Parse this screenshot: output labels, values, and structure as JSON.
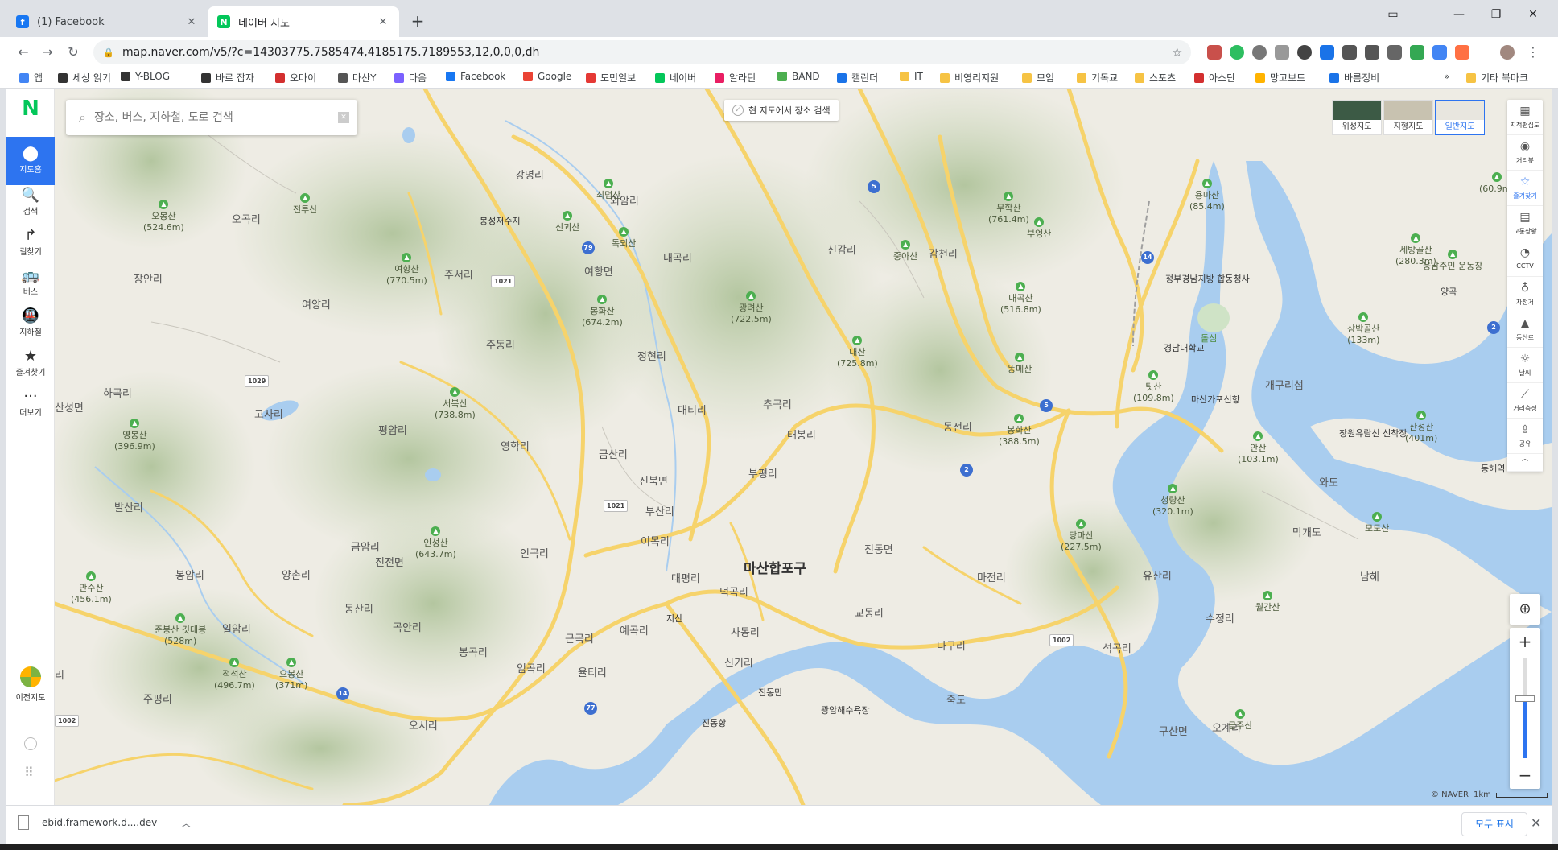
{
  "browser": {
    "tabs": [
      {
        "title": "(1) Facebook",
        "icon": "facebook-icon",
        "color": "#1877f2"
      },
      {
        "title": "네이버 지도",
        "icon": "naver-map-icon",
        "color": "#03c75a"
      }
    ],
    "url": "map.naver.com/v5/?c=14303775.7585474,4185175.7189553,12,0,0,0,dh"
  },
  "bookmarks": [
    {
      "label": "앱",
      "color": "#4285f4"
    },
    {
      "label": "세상 읽기",
      "color": "#333"
    },
    {
      "label": "Y-BLOG",
      "color": "#333"
    },
    {
      "label": "바로 잡자",
      "color": "#333"
    },
    {
      "label": "오마이",
      "color": "#d32f2f"
    },
    {
      "label": "마산Y",
      "color": "#555"
    },
    {
      "label": "다음",
      "color": "#7b61ff"
    },
    {
      "label": "Facebook",
      "color": "#1877f2"
    },
    {
      "label": "Google",
      "color": "#ea4335"
    },
    {
      "label": "도민일보",
      "color": "#e53935"
    },
    {
      "label": "네이버",
      "color": "#03c75a"
    },
    {
      "label": "알라딘",
      "color": "#e91e63"
    },
    {
      "label": "BAND",
      "color": "#4caf50"
    },
    {
      "label": "캘린더",
      "color": "#1a73e8"
    },
    {
      "label": "IT",
      "color": "#f6c344"
    },
    {
      "label": "비영리지원",
      "color": "#f6c344"
    },
    {
      "label": "모임",
      "color": "#f6c344"
    },
    {
      "label": "기독교",
      "color": "#f6c344"
    },
    {
      "label": "스포츠",
      "color": "#f6c344"
    },
    {
      "label": "아스단",
      "color": "#d32f2f"
    },
    {
      "label": "망고보드",
      "color": "#ffb300"
    },
    {
      "label": "바름정비",
      "color": "#1a73e8"
    }
  ],
  "bookmarks_more": "»",
  "bookmarks_other": "기타 북마크",
  "sidebar": {
    "logo": "N",
    "items": [
      {
        "label": "지도홈",
        "icon": "pin-icon",
        "glyph": "⬤"
      },
      {
        "label": "검색",
        "icon": "search-icon",
        "glyph": "🔍"
      },
      {
        "label": "길찾기",
        "icon": "directions-icon",
        "glyph": "↱"
      },
      {
        "label": "버스",
        "icon": "bus-icon",
        "glyph": "🚌"
      },
      {
        "label": "지하철",
        "icon": "subway-icon",
        "glyph": "🚇"
      },
      {
        "label": "즐겨찾기",
        "icon": "star-icon",
        "glyph": "★"
      },
      {
        "label": "더보기",
        "icon": "more-icon",
        "glyph": "···"
      }
    ],
    "legacy": "이전지도"
  },
  "search": {
    "placeholder": "장소, 버스, 지하철, 도로 검색"
  },
  "here_search": "현 지도에서 장소 검색",
  "map_types": [
    {
      "label": "위성지도",
      "color": "#3c5a45"
    },
    {
      "label": "지형지도",
      "color": "#c8c2b0"
    },
    {
      "label": "일반지도",
      "color": "#e8e6df"
    }
  ],
  "tools": [
    {
      "label": "지적편집도",
      "glyph": "▦"
    },
    {
      "label": "거리뷰",
      "glyph": "◉"
    },
    {
      "label": "즐겨찾기",
      "glyph": "☆"
    },
    {
      "label": "교통상황",
      "glyph": "▤"
    },
    {
      "label": "CCTV",
      "glyph": "◔"
    },
    {
      "label": "자전거",
      "glyph": "♁"
    },
    {
      "label": "등산로",
      "glyph": "▲"
    },
    {
      "label": "날씨",
      "glyph": "☼"
    },
    {
      "label": "거리측정",
      "glyph": "⟋"
    },
    {
      "label": "공유",
      "glyph": "⇪"
    }
  ],
  "zoom": {
    "level_fraction": 0.4
  },
  "scale": {
    "copyright": "© NAVER",
    "distance": "1km"
  },
  "map": {
    "city": "마산합포구",
    "towns": [
      {
        "name": "오곡리"
      },
      {
        "name": "장안리"
      },
      {
        "name": "여양리"
      },
      {
        "name": "하곡리"
      },
      {
        "name": "고사리"
      },
      {
        "name": "평암리"
      },
      {
        "name": "발산리"
      },
      {
        "name": "금암리"
      },
      {
        "name": "진전면"
      },
      {
        "name": "양촌리"
      },
      {
        "name": "동산리"
      },
      {
        "name": "곡안리"
      },
      {
        "name": "일암리"
      },
      {
        "name": "봉암리"
      },
      {
        "name": "주평리"
      },
      {
        "name": "주서리"
      },
      {
        "name": "주동리"
      },
      {
        "name": "여항면"
      },
      {
        "name": "영학리"
      },
      {
        "name": "인곡리"
      },
      {
        "name": "금산리"
      },
      {
        "name": "진북면"
      },
      {
        "name": "이목리"
      },
      {
        "name": "부산리"
      },
      {
        "name": "대티리"
      },
      {
        "name": "정현리"
      },
      {
        "name": "내곡리"
      },
      {
        "name": "외암리"
      },
      {
        "name": "강명리"
      },
      {
        "name": "추곡리"
      },
      {
        "name": "부평리"
      },
      {
        "name": "태봉리"
      },
      {
        "name": "신감리"
      },
      {
        "name": "감천리"
      },
      {
        "name": "동전리"
      },
      {
        "name": "진동면"
      },
      {
        "name": "마전리"
      },
      {
        "name": "교동리"
      },
      {
        "name": "대평리"
      },
      {
        "name": "덕곡리"
      },
      {
        "name": "사동리"
      },
      {
        "name": "예곡리"
      },
      {
        "name": "근곡리"
      },
      {
        "name": "봉곡리"
      },
      {
        "name": "임곡리"
      },
      {
        "name": "율티리"
      },
      {
        "name": "신기리"
      },
      {
        "name": "다구리"
      },
      {
        "name": "유산리"
      },
      {
        "name": "수정리"
      },
      {
        "name": "석곡리"
      },
      {
        "name": "구산면"
      },
      {
        "name": "오계리"
      },
      {
        "name": "오서리"
      },
      {
        "name": "개구리섬"
      },
      {
        "name": "막개도"
      },
      {
        "name": "와도"
      },
      {
        "name": "죽도"
      },
      {
        "name": "남해"
      },
      {
        "name": "리"
      },
      {
        "name": "산성면"
      }
    ],
    "mountains": [
      {
        "name": "오봉산",
        "elev": "(524.6m)"
      },
      {
        "name": "여항산",
        "elev": "(770.5m)"
      },
      {
        "name": "봉화산",
        "elev": "(674.2m)"
      },
      {
        "name": "광려산",
        "elev": "(722.5m)"
      },
      {
        "name": "대산",
        "elev": "(725.8m)"
      },
      {
        "name": "무학산",
        "elev": "(761.4m)"
      },
      {
        "name": "대곡산",
        "elev": "(516.8m)"
      },
      {
        "name": "서북산",
        "elev": "(738.8m)"
      },
      {
        "name": "영봉산",
        "elev": "(396.9m)"
      },
      {
        "name": "인성산",
        "elev": "(643.7m)"
      },
      {
        "name": "만수산",
        "elev": "(456.1m)"
      },
      {
        "name": "준봉산 깃대봉",
        "elev": "(528m)"
      },
      {
        "name": "적석산",
        "elev": "(496.7m)"
      },
      {
        "name": "으봉산",
        "elev": "(371m)"
      },
      {
        "name": "봉화산",
        "elev": "(388.5m)"
      },
      {
        "name": "팃산",
        "elev": "(109.8m)"
      },
      {
        "name": "청량산",
        "elev": "(320.1m)"
      },
      {
        "name": "당마산",
        "elev": "(227.5m)"
      },
      {
        "name": "안산",
        "elev": "(103.1m)"
      },
      {
        "name": "용마산",
        "elev": "(85.4m)"
      },
      {
        "name": "세방골산",
        "elev": "(280.3m)"
      },
      {
        "name": "삼박골산",
        "elev": "(133m)"
      },
      {
        "name": "산성산",
        "elev": "(401m)"
      },
      {
        "name": "모도산",
        "elev": ""
      },
      {
        "name": "월간산",
        "elev": ""
      },
      {
        "name": "금주산",
        "elev": ""
      },
      {
        "name": "전투산",
        "elev": ""
      },
      {
        "name": "쇠덤산",
        "elev": ""
      },
      {
        "name": "신괴산",
        "elev": ""
      },
      {
        "name": "독뫼산",
        "elev": ""
      },
      {
        "name": "중아산",
        "elev": ""
      },
      {
        "name": "부엉산",
        "elev": ""
      },
      {
        "name": "똥메산",
        "elev": ""
      },
      {
        "name": "웅남주민 운동장",
        "elev": ""
      },
      {
        "name": "",
        "elev": "(60.9m)"
      }
    ],
    "pois": [
      {
        "name": "봉성저수지"
      },
      {
        "name": "정부경남지방 합동청사"
      },
      {
        "name": "경남대학교"
      },
      {
        "name": "마산가포신항"
      },
      {
        "name": "창원유람선 선착장"
      },
      {
        "name": "돌섬"
      },
      {
        "name": "지산"
      },
      {
        "name": "진동만"
      },
      {
        "name": "광암해수욕장"
      },
      {
        "name": "진동항"
      },
      {
        "name": "양곡"
      },
      {
        "name": "동해역"
      }
    ],
    "routes": [
      {
        "num": "5",
        "kind": "blue"
      },
      {
        "num": "79",
        "kind": "blue"
      },
      {
        "num": "1021",
        "kind": "white"
      },
      {
        "num": "1029",
        "kind": "white"
      },
      {
        "num": "14",
        "kind": "blue"
      },
      {
        "num": "5",
        "kind": "blue"
      },
      {
        "num": "2",
        "kind": "blue"
      },
      {
        "num": "1021",
        "kind": "white"
      },
      {
        "num": "14",
        "kind": "blue"
      },
      {
        "num": "77",
        "kind": "blue"
      },
      {
        "num": "1002",
        "kind": "white"
      },
      {
        "num": "1002",
        "kind": "white"
      },
      {
        "num": "2",
        "kind": "blue"
      }
    ]
  },
  "downloads": {
    "file": "ebid.framework.d....dev",
    "show_all": "모두 표시"
  }
}
